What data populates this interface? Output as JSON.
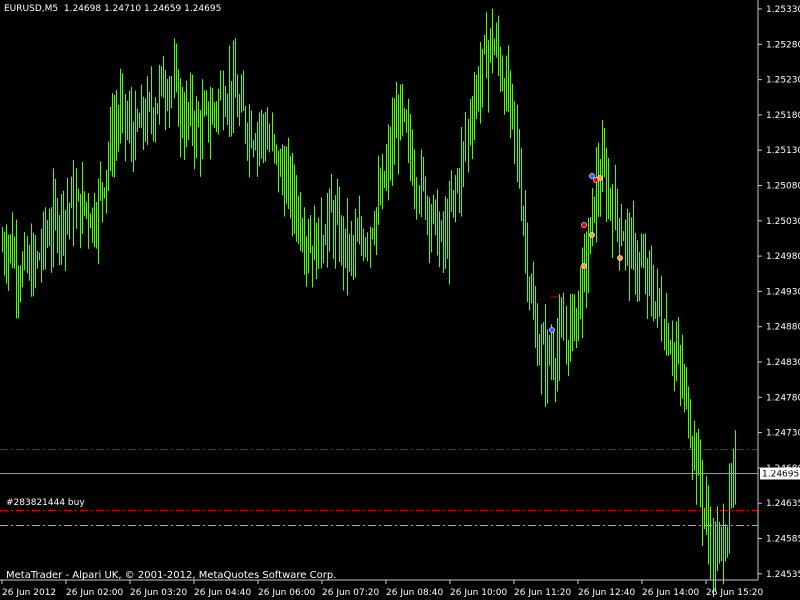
{
  "window": {
    "symbol": "EURUSD,M5",
    "ohlc_text": "1.24698 1.24710 1.24659 1.24695",
    "copyright": "MetaTrader - Alpari UK, © 2001-2012, MetaQuotes Software Corp.",
    "trade_label": "#283821444 buy"
  },
  "colors": {
    "background": "#000000",
    "candle": "#4cff00",
    "red_line": "#d40000",
    "green_line": "#4cff00",
    "bid_line": "#8d96a8",
    "axis": "#c8c8c8"
  },
  "chart_data": {
    "type": "line",
    "ylim": [
      1.2455,
      1.2533
    ],
    "y_ticks": [
      "1.25330",
      "1.25280",
      "1.25230",
      "1.25180",
      "1.25130",
      "1.25080",
      "1.25030",
      "1.24980",
      "1.24930",
      "1.24880",
      "1.24830",
      "1.24780",
      "1.24730",
      "1.24680",
      "1.24635",
      "1.24585",
      "1.24535"
    ],
    "x_ticks": [
      "26 Jun 2012",
      "26 Jun 02:00",
      "26 Jun 03:20",
      "26 Jun 04:40",
      "26 Jun 06:00",
      "26 Jun 07:20",
      "26 Jun 08:40",
      "26 Jun 10:00",
      "26 Jun 11:20",
      "26 Jun 12:40",
      "26 Jun 14:00",
      "26 Jun 15:20"
    ],
    "current_price": "1.24695",
    "levels": [
      {
        "name": "red-upper",
        "price": 1.24728,
        "style": "dashdot",
        "color": "#d40000"
      },
      {
        "name": "red-lower",
        "price": 1.24645,
        "style": "dashdot",
        "color": "#d40000"
      },
      {
        "name": "green-entry",
        "price": 1.24625,
        "style": "dashdot",
        "color": "#4cff00"
      }
    ],
    "close_series": [
      1.25,
      1.2501,
      1.2498,
      1.2497,
      1.2497,
      1.2498,
      1.2501,
      1.2503,
      1.2504,
      1.2505,
      1.2506,
      1.2505,
      1.2506,
      1.2504,
      1.2507,
      1.2512,
      1.2516,
      1.2518,
      1.2516,
      1.2515,
      1.2517,
      1.2518,
      1.252,
      1.2522,
      1.2523,
      1.252,
      1.2517,
      1.2518,
      1.2516,
      1.2517,
      1.2518,
      1.252,
      1.2522,
      1.2521,
      1.2518,
      1.2517,
      1.2516,
      1.2516,
      1.2515,
      1.2512,
      1.251,
      1.2508,
      1.2506,
      1.2503,
      1.2501,
      1.25,
      1.2503,
      1.2504,
      1.2502,
      1.25,
      1.2499,
      1.25,
      1.2502,
      1.2504,
      1.2506,
      1.251,
      1.2515,
      1.2518,
      1.2514,
      1.2511,
      1.2508,
      1.2506,
      1.2503,
      1.25,
      1.2503,
      1.2508,
      1.2512,
      1.2518,
      1.2522,
      1.2525,
      1.2528,
      1.2526,
      1.2522,
      1.2518,
      1.251,
      1.25,
      1.249,
      1.2486,
      1.2485,
      1.2486,
      1.2487,
      1.2488,
      1.2491,
      1.2495,
      1.25,
      1.2508,
      1.251,
      1.2507,
      1.2504,
      1.2502,
      1.2499,
      1.2498,
      1.2496,
      1.2494,
      1.2492,
      1.2489,
      1.2487,
      1.2483,
      1.2479,
      1.2474,
      1.2468,
      1.2462,
      1.2458,
      1.246,
      1.2464,
      1.2469
    ]
  }
}
